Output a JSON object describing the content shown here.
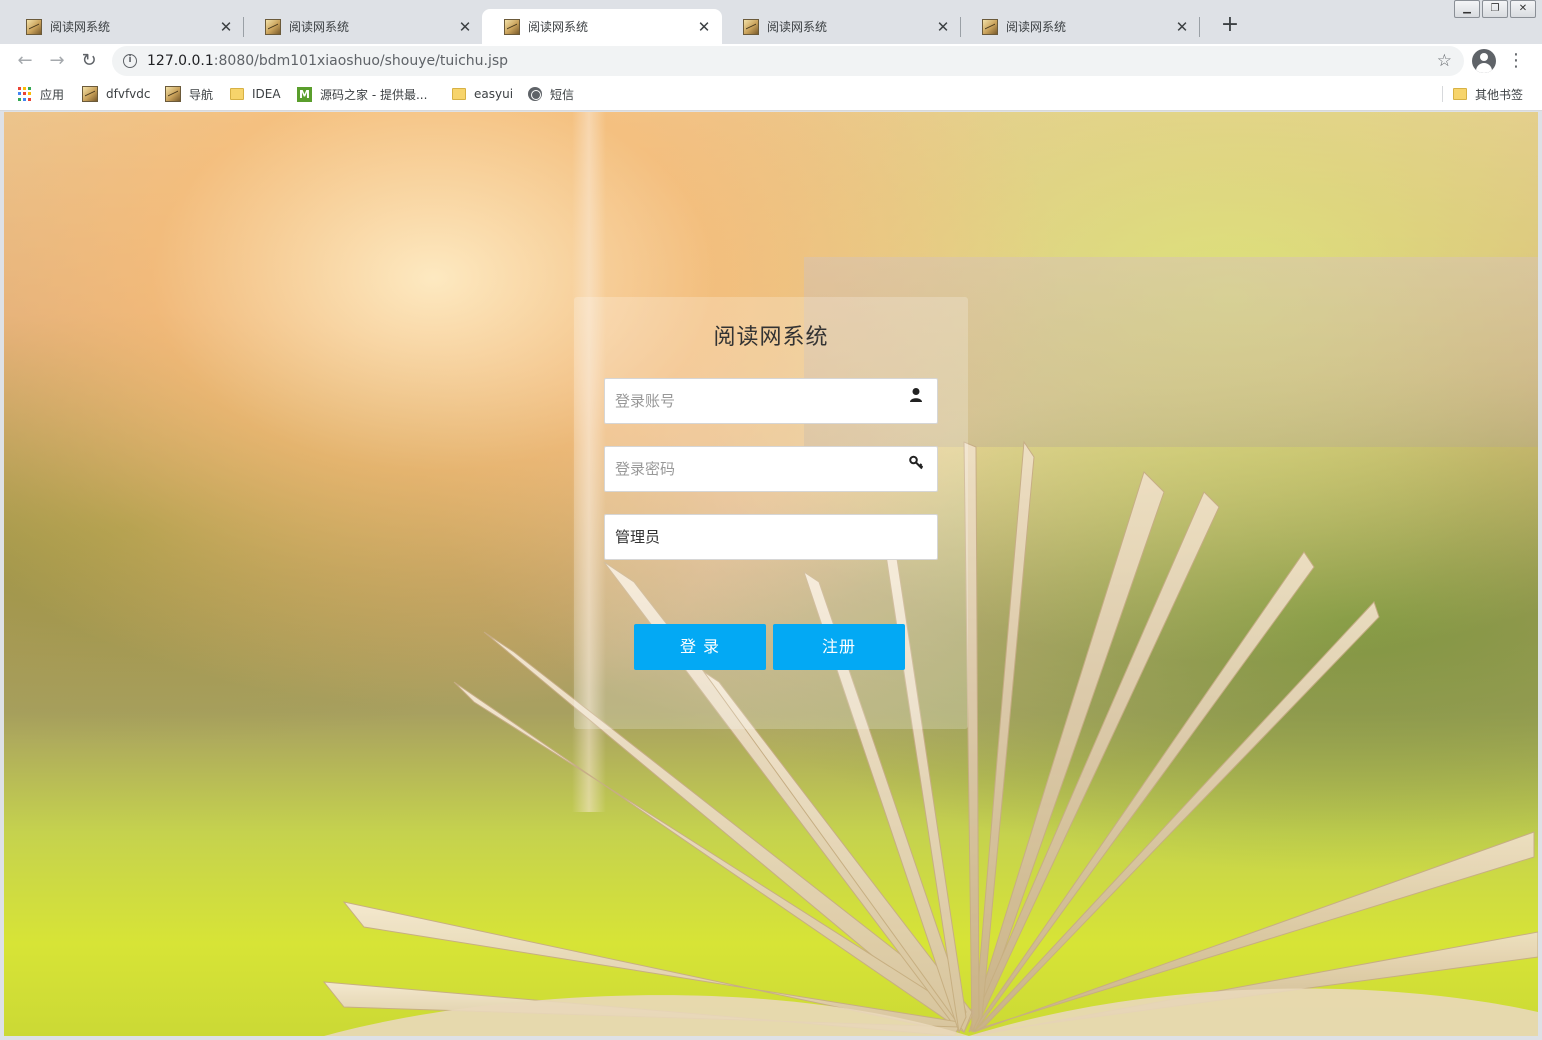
{
  "browser": {
    "tabs": [
      {
        "title": "阅读网系统",
        "active": false
      },
      {
        "title": "阅读网系统",
        "active": false
      },
      {
        "title": "阅读网系统",
        "active": true
      },
      {
        "title": "阅读网系统",
        "active": false
      },
      {
        "title": "阅读网系统",
        "active": false
      }
    ],
    "url_host": "127.0.0.1",
    "url_rest": ":8080/bdm101xiaoshuo/shouye/tuichu.jsp",
    "bookmarks": [
      {
        "label": "应用",
        "icon": "apps-icon"
      },
      {
        "label": "dfvfvdc",
        "icon": "page-icon"
      },
      {
        "label": "导航",
        "icon": "page-icon"
      },
      {
        "label": "IDEA",
        "icon": "folder-icon"
      },
      {
        "label": "源码之家 - 提供最...",
        "icon": "m-icon"
      },
      {
        "label": "easyui",
        "icon": "folder-icon"
      },
      {
        "label": "短信",
        "icon": "globe-icon"
      }
    ],
    "other_bookmarks": "其他书签"
  },
  "login": {
    "title": "阅读网系统",
    "account_placeholder": "登录账号",
    "password_placeholder": "登录密码",
    "role_value": "管理员",
    "login_button": "登 录",
    "register_button": "注册"
  },
  "colors": {
    "button": "#03a9f4",
    "panel": "rgba(255,255,255,0.22)"
  }
}
